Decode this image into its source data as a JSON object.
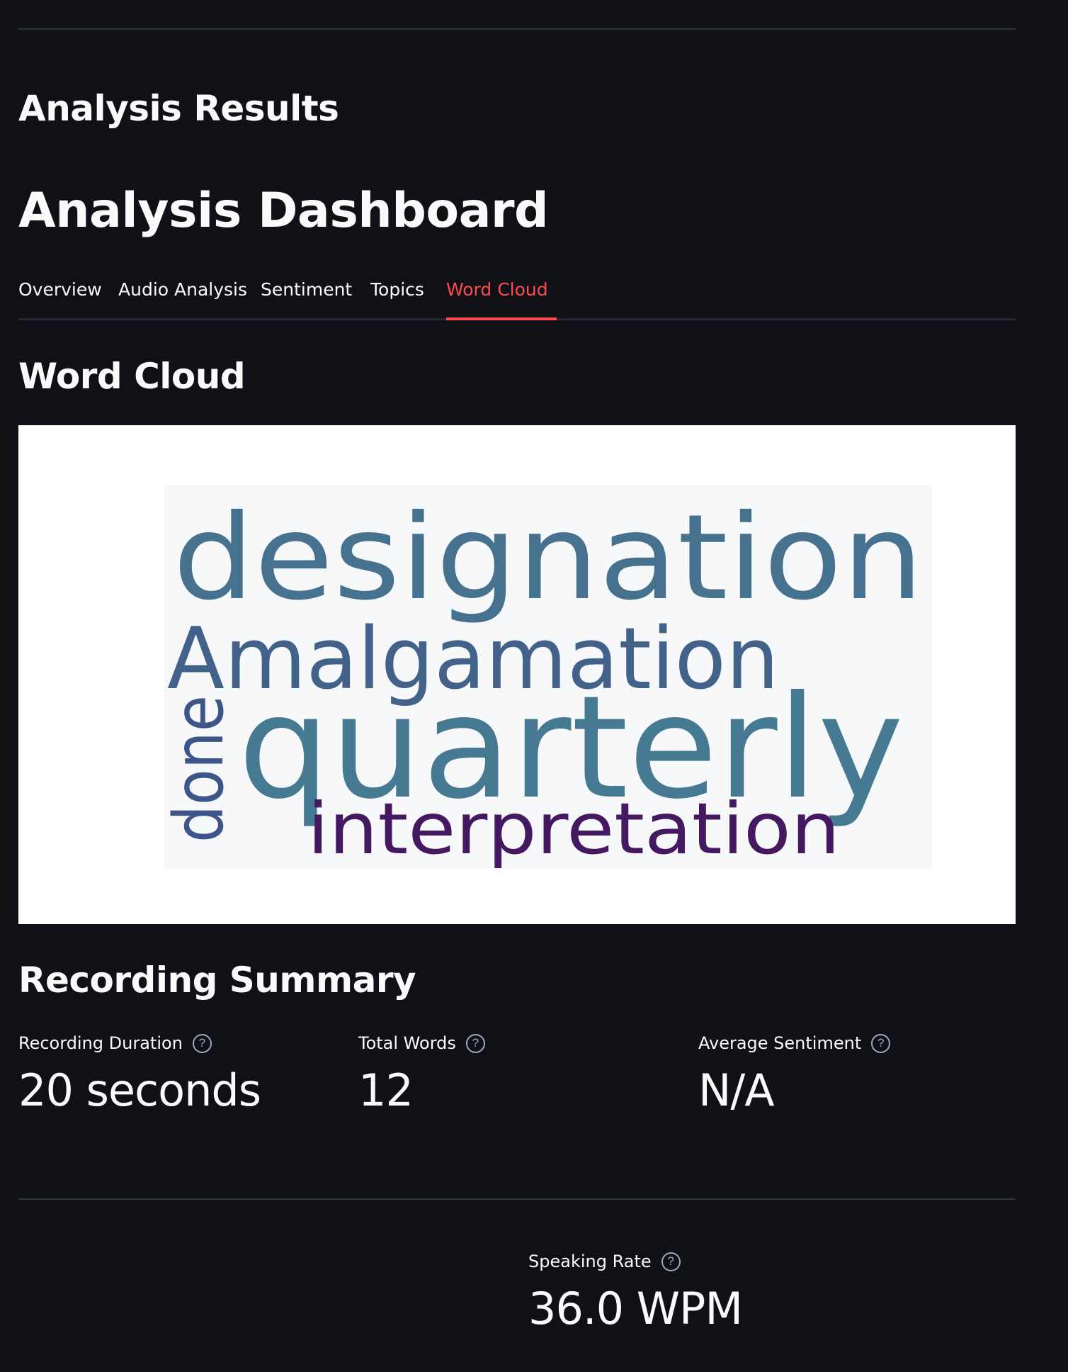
{
  "section_title": "Analysis Results",
  "dashboard_title": "Analysis Dashboard",
  "tabs": [
    {
      "label": "Overview",
      "active": false
    },
    {
      "label": "Audio Analysis",
      "active": false
    },
    {
      "label": "Sentiment",
      "active": false
    },
    {
      "label": "Topics",
      "active": false
    },
    {
      "label": "Word Cloud",
      "active": true
    }
  ],
  "word_cloud": {
    "title": "Word Cloud",
    "words": [
      {
        "text": "designation",
        "color": "#46728f"
      },
      {
        "text": "Amalgamation",
        "color": "#43628a"
      },
      {
        "text": "quarterly",
        "color": "#457a92"
      },
      {
        "text": "interpretation",
        "color": "#45195f"
      },
      {
        "text": "done",
        "color": "#3d5589"
      }
    ],
    "background": "#f7f8fa"
  },
  "summary": {
    "title": "Recording Summary",
    "metrics": [
      {
        "label": "Recording Duration",
        "value": "20 seconds"
      },
      {
        "label": "Total Words",
        "value": "12"
      },
      {
        "label": "Average Sentiment",
        "value": "N/A"
      }
    ],
    "speaking_rate": {
      "label": "Speaking Rate",
      "value": "36.0 WPM"
    }
  },
  "colors": {
    "accent": "#ff4b4b",
    "background": "#0f1117",
    "text": "#fafafa"
  }
}
